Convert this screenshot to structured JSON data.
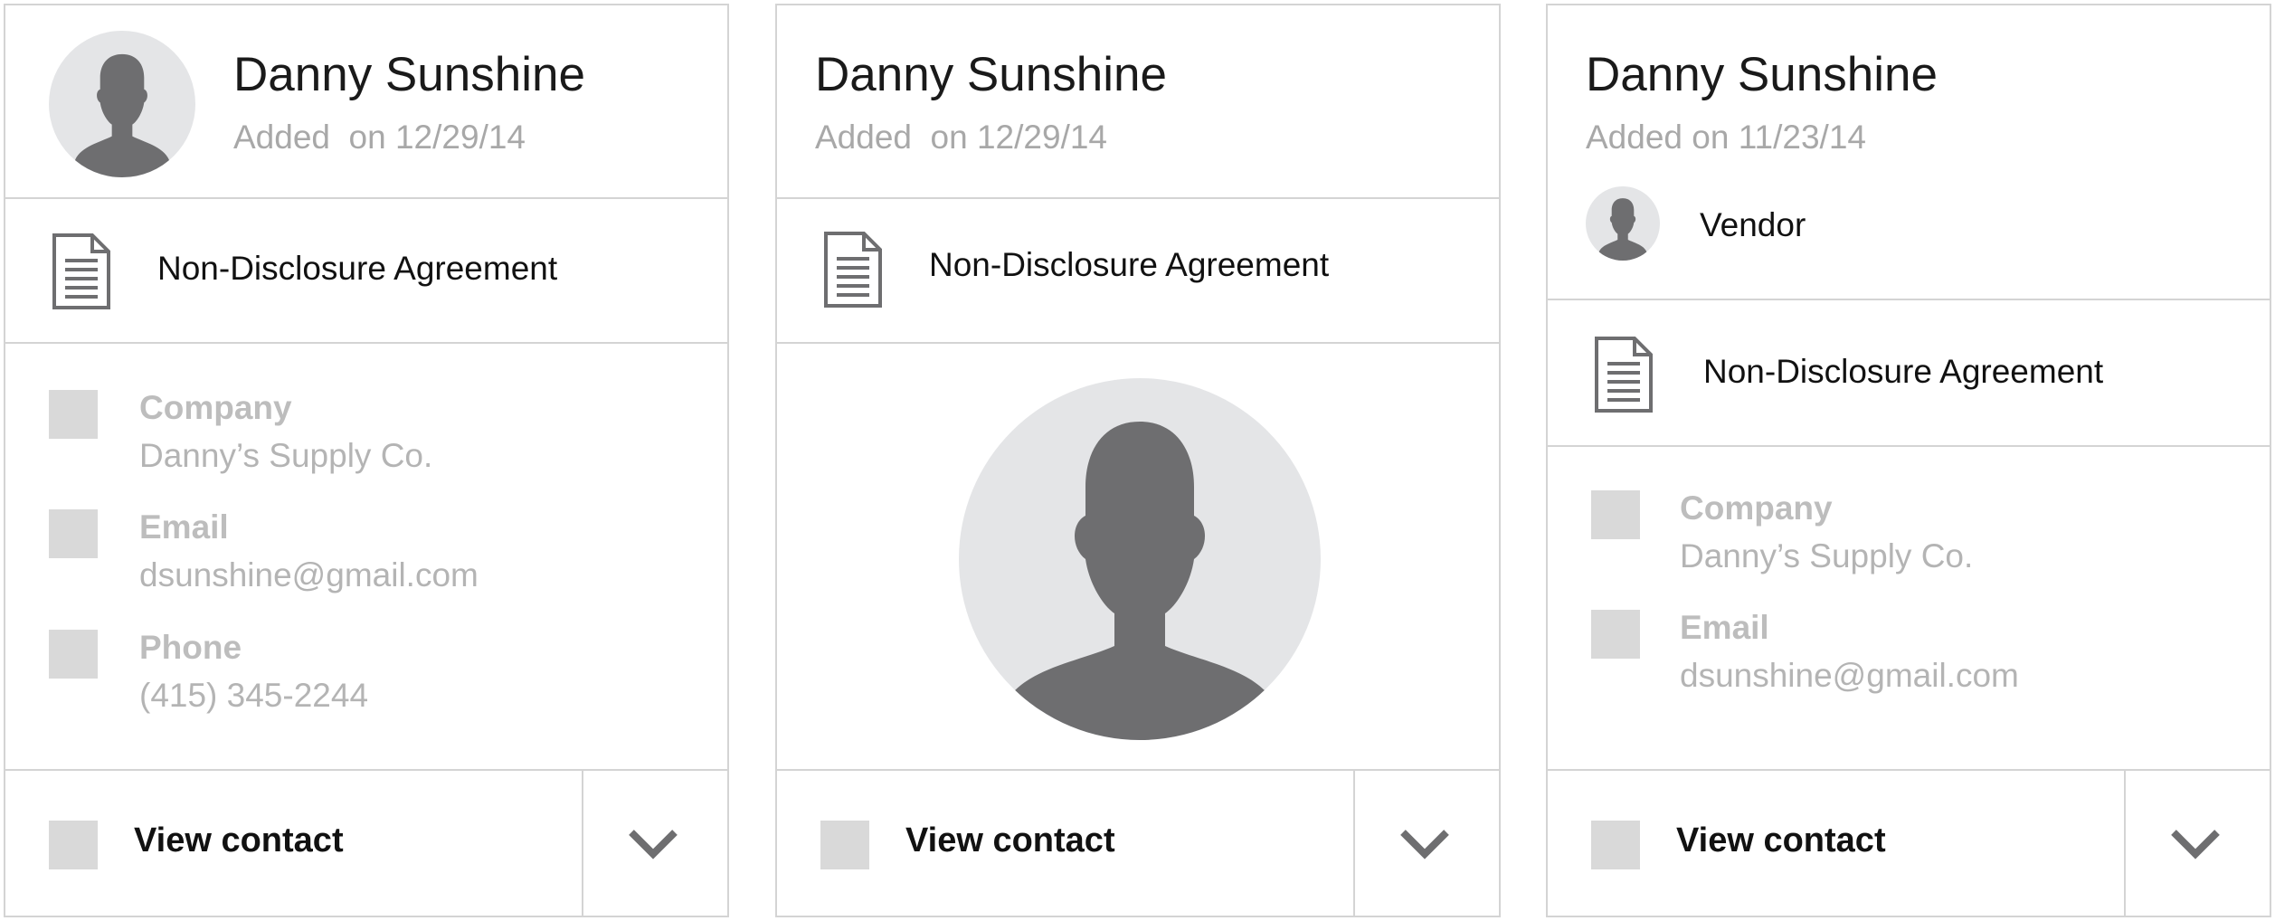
{
  "cards": [
    {
      "name": "Danny Sunshine",
      "added": "Added  on 12/29/14",
      "document": "Non-Disclosure Agreement",
      "fields": [
        {
          "label": "Company",
          "value": "Danny’s Supply Co."
        },
        {
          "label": "Email",
          "value": "dsunshine@gmail.com"
        },
        {
          "label": "Phone",
          "value": "(415) 345-2244"
        }
      ],
      "view_contact": "View contact"
    },
    {
      "name": "Danny Sunshine",
      "added": "Added  on 12/29/14",
      "document": "Non-Disclosure Agreement",
      "view_contact": "View contact"
    },
    {
      "name": "Danny Sunshine",
      "added": "Added on 11/23/14",
      "role": "Vendor",
      "document": "Non-Disclosure Agreement",
      "fields": [
        {
          "label": "Company",
          "value": "Danny’s Supply Co."
        },
        {
          "label": "Email",
          "value": "dsunshine@gmail.com"
        }
      ],
      "view_contact": "View contact"
    }
  ],
  "icons": {
    "avatar": "person-silhouette-icon",
    "document": "document-icon",
    "expand": "chevron-down-icon"
  },
  "colors": {
    "border": "#d4d4d4",
    "avatar_bg": "#e4e5e7",
    "silhouette": "#6e6e70",
    "placeholder_box": "#d9d9d9"
  }
}
